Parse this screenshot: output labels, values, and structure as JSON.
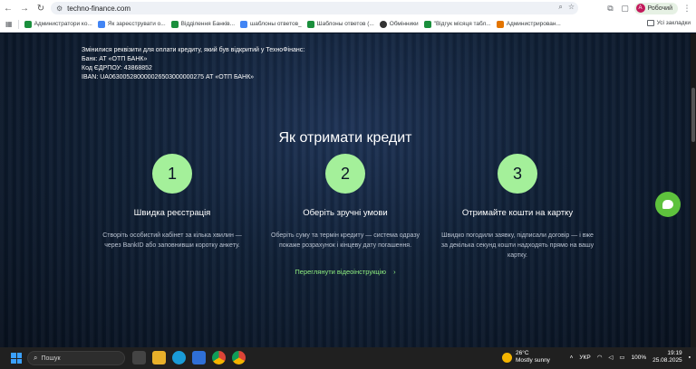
{
  "browser": {
    "url": "techno-finance.com",
    "profile_name": "Робочий",
    "profile_initial": "А"
  },
  "bookmarks": [
    {
      "label": "Администратори ко...",
      "color": "#1a8f3c"
    },
    {
      "label": "Як зареєструвати о...",
      "color": "#4285f4"
    },
    {
      "label": "Відділення Банків...",
      "color": "#1a8f3c"
    },
    {
      "label": "шаблоны ответов_",
      "color": "#4285f4"
    },
    {
      "label": "Шаблоны ответов (...",
      "color": "#1a8f3c"
    },
    {
      "label": "Обмінники",
      "color": "#333333"
    },
    {
      "label": "\"Відгук місяця табл...",
      "color": "#1a8f3c"
    },
    {
      "label": "Администрирован...",
      "color": "#e37400"
    }
  ],
  "all_bookmarks": "Усі закладки",
  "notice": {
    "line1": "Змінилися реквізити для оплати кредиту, який був відкритий у ТехноФінанс:",
    "line2": "Банк: АТ «ОТП БАНК»",
    "line3": "Код ЄДРПОУ: 43868852",
    "line4": "IBAN: UA063005280000026503000000275 АТ «ОТП БАНК»"
  },
  "section": {
    "heading": "Як отримати кредит",
    "steps": [
      {
        "number": "1",
        "title": "Швидка реєстрація",
        "desc": "Створіть особистий кабінет за кілька хвилин — через BankID або заповнивши коротку анкету."
      },
      {
        "number": "2",
        "title": "Оберіть зручні умови",
        "desc": "Оберіть суму та термін кредиту — система одразу покаже розрахунок і кінцеву дату погашення."
      },
      {
        "number": "3",
        "title": "Отримайте кошти на картку",
        "desc": "Швидко погодили заявку, підписали договір — і вже за декілька секунд кошти надходять прямо на вашу картку."
      }
    ],
    "video_link": "Переглянути відеоінструкцію",
    "video_arrow": "›"
  },
  "taskbar": {
    "search_placeholder": "Пошук",
    "weather_temp": "26°C",
    "weather_desc": "Mostly sunny",
    "lang": "УКР",
    "battery": "100%",
    "time": "19:19",
    "date": "25.08.2025"
  }
}
